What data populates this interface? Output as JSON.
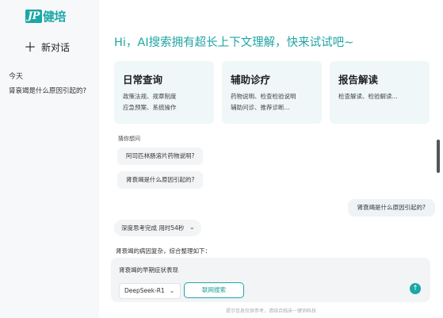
{
  "brand": {
    "logo_mark": "JP",
    "logo_text": "健培",
    "accent": "#1aa7a6"
  },
  "sidebar": {
    "new_chat_label": "新对话",
    "section_today": "今天",
    "history": [
      "肾衰竭是什么原因引起的?"
    ]
  },
  "main": {
    "headline": "Hi，AI搜索拥有超长上下文理解，快来试试吧~",
    "cards": [
      {
        "title": "日常查询",
        "lines": [
          "政策法规、规章制度",
          "应急预案、系统操作"
        ]
      },
      {
        "title": "辅助诊疗",
        "lines": [
          "药物说明、检查检验说明",
          "辅助问诊、推荐诊断..."
        ]
      },
      {
        "title": "报告解读",
        "lines": [
          "检查解读、检验解读..."
        ]
      }
    ],
    "guess_label": "猜你想问",
    "suggestions": [
      "阿司匹林肠溶片药物说明?",
      "肾衰竭是什么原因引起的?"
    ],
    "user_message": "肾衰竭是什么原因引起的?",
    "thinking_status": "深度思考完成 用时54秒",
    "answer_intro": "肾衰竭的病因复杂，综合整理如下：",
    "input": {
      "text": "肾衰竭的早期症状表现",
      "model": "DeepSeek-R1",
      "web_search": "联网搜索"
    },
    "footer": "提示信息仅供参考，请结合临床一键询科技"
  }
}
